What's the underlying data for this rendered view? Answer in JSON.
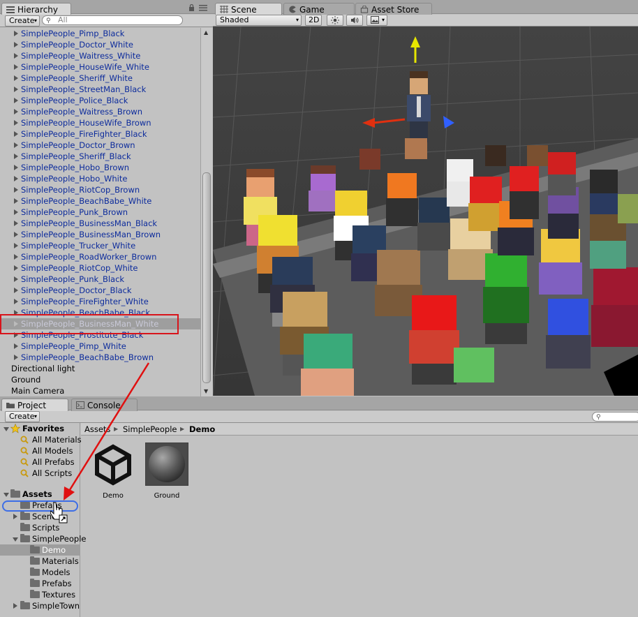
{
  "hierarchy": {
    "tab_label": "Hierarchy",
    "create_label": "Create",
    "search_placeholder": "All",
    "items": [
      {
        "label": "SimplePeople_Pimp_Black",
        "expandable": true
      },
      {
        "label": "SimplePeople_Doctor_White",
        "expandable": true
      },
      {
        "label": "SimplePeople_Waitress_White",
        "expandable": true
      },
      {
        "label": "SimplePeople_HouseWife_White",
        "expandable": true
      },
      {
        "label": "SimplePeople_Sheriff_White",
        "expandable": true
      },
      {
        "label": "SimplePeople_StreetMan_Black",
        "expandable": true
      },
      {
        "label": "SimplePeople_Police_Black",
        "expandable": true
      },
      {
        "label": "SimplePeople_Waitress_Brown",
        "expandable": true
      },
      {
        "label": "SimplePeople_HouseWife_Brown",
        "expandable": true
      },
      {
        "label": "SimplePeople_FireFighter_Black",
        "expandable": true
      },
      {
        "label": "SimplePeople_Doctor_Brown",
        "expandable": true
      },
      {
        "label": "SimplePeople_Sheriff_Black",
        "expandable": true
      },
      {
        "label": "SimplePeople_Hobo_Brown",
        "expandable": true
      },
      {
        "label": "SimplePeople_Hobo_White",
        "expandable": true
      },
      {
        "label": "SimplePeople_RiotCop_Brown",
        "expandable": true
      },
      {
        "label": "SimplePeople_BeachBabe_White",
        "expandable": true
      },
      {
        "label": "SimplePeople_Punk_Brown",
        "expandable": true
      },
      {
        "label": "SimplePeople_BusinessMan_Black",
        "expandable": true
      },
      {
        "label": "SimplePeople_BusinessMan_Brown",
        "expandable": true
      },
      {
        "label": "SimplePeople_Trucker_White",
        "expandable": true
      },
      {
        "label": "SimplePeople_RoadWorker_Brown",
        "expandable": true
      },
      {
        "label": "SimplePeople_RiotCop_White",
        "expandable": true
      },
      {
        "label": "SimplePeople_Punk_Black",
        "expandable": true
      },
      {
        "label": "SimplePeople_Doctor_Black",
        "expandable": true
      },
      {
        "label": "SimplePeople_FireFighter_White",
        "expandable": true
      },
      {
        "label": "SimplePeople_BeachBabe_Black",
        "expandable": true
      },
      {
        "label": "SimplePeople_BusinessMan_White",
        "expandable": true,
        "selected": true
      },
      {
        "label": "SimplePeople_Prostitute_Black",
        "expandable": true
      },
      {
        "label": "SimplePeople_Pimp_White",
        "expandable": true
      },
      {
        "label": "SimplePeople_BeachBabe_Brown",
        "expandable": true
      },
      {
        "label": "Directional light",
        "expandable": false
      },
      {
        "label": "Ground",
        "expandable": false
      },
      {
        "label": "Main Camera",
        "expandable": false
      }
    ]
  },
  "scene": {
    "tabs": [
      {
        "label": "Scene",
        "active": true,
        "icon": "grid-icon"
      },
      {
        "label": "Game",
        "active": false,
        "icon": "pacman-icon"
      },
      {
        "label": "Asset Store",
        "active": false,
        "icon": "store-icon"
      }
    ],
    "shading_mode": "Shaded",
    "mode_2d_label": "2D",
    "toolbar_icons": [
      "sun-icon",
      "speaker-icon",
      "image-icon"
    ],
    "background_color": "#3c3c3c",
    "grid_color": "#6b6b6b"
  },
  "project": {
    "tabs": [
      {
        "label": "Project",
        "active": true
      },
      {
        "label": "Console",
        "active": false
      }
    ],
    "create_label": "Create",
    "breadcrumb": [
      "Assets",
      "SimplePeople",
      "Demo"
    ],
    "favorites_label": "Favorites",
    "favorites": [
      "All Materials",
      "All Models",
      "All Prefabs",
      "All Scripts"
    ],
    "assets_label": "Assets",
    "tree": [
      {
        "label": "Prefabs",
        "indent": 1,
        "state": "none",
        "highlighted": true
      },
      {
        "label": "Scenes",
        "indent": 1,
        "state": "collapsed"
      },
      {
        "label": "Scripts",
        "indent": 1,
        "state": "none"
      },
      {
        "label": "SimplePeople",
        "indent": 1,
        "state": "expanded"
      },
      {
        "label": "Demo",
        "indent": 2,
        "state": "none",
        "selected": true
      },
      {
        "label": "Materials",
        "indent": 2,
        "state": "none"
      },
      {
        "label": "Models",
        "indent": 2,
        "state": "none"
      },
      {
        "label": "Prefabs",
        "indent": 2,
        "state": "none"
      },
      {
        "label": "Textures",
        "indent": 2,
        "state": "none"
      },
      {
        "label": "SimpleTown",
        "indent": 1,
        "state": "collapsed"
      }
    ],
    "assets": [
      {
        "name": "Demo",
        "icon": "unity-logo-icon"
      },
      {
        "name": "Ground",
        "icon": "sphere-material-icon"
      }
    ]
  },
  "colors": {
    "panel_bg": "#c2c2c2",
    "hierarchy_text": "#0c2b9c",
    "highlight_red": "#d8141b",
    "selection_blue": "#3d6ee6",
    "scene_bg": "#3c3c3c"
  }
}
